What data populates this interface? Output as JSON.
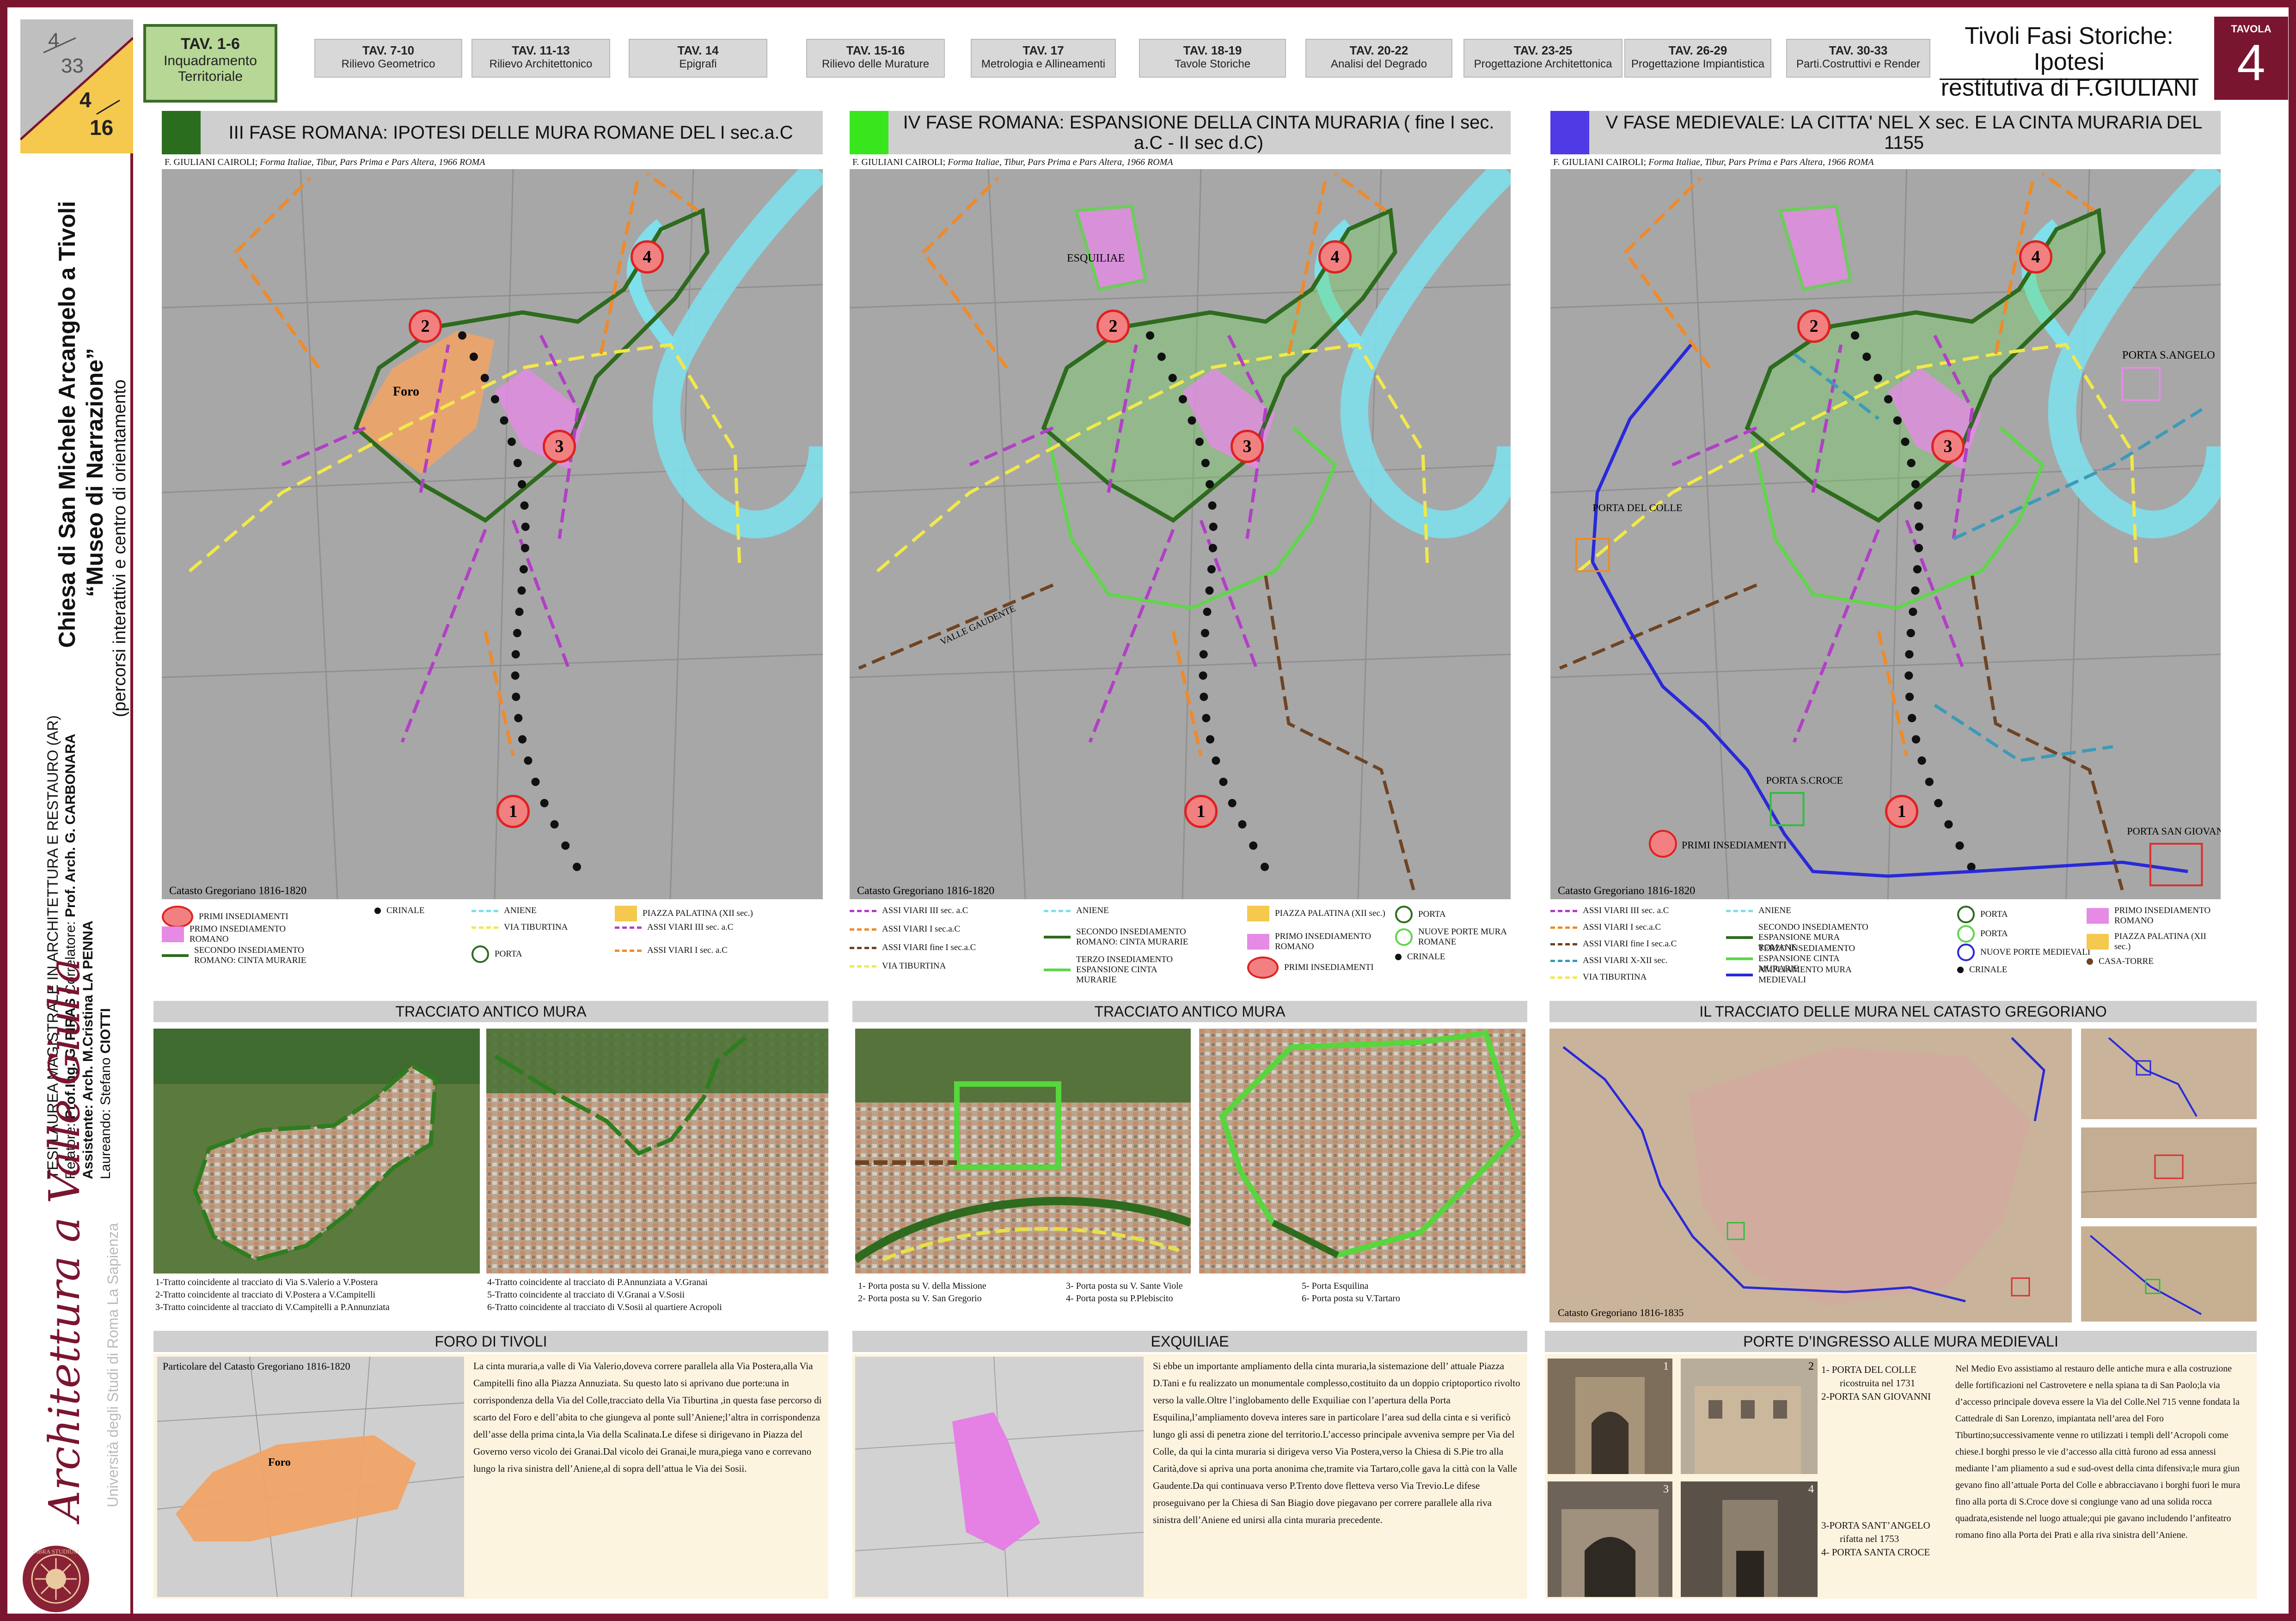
{
  "colors": {
    "frame": "#7a1530",
    "active_tab": "#b7d796",
    "phase3": "#2a6d1f",
    "phase4": "#39e61d",
    "phase5": "#4f3ae6",
    "aniene": "#7fdfeb",
    "walls_dark": "#2e6b1e",
    "walls_light": "#5fd64a",
    "walls_blue": "#2929d9",
    "viari3": "#b23fc6",
    "viari1": "#f08a28",
    "viari_fine": "#6e4424",
    "tiburtina": "#f2e84a",
    "viari_x": "#3d9ab8"
  },
  "page_badge": {
    "top": "4",
    "top_den": "33",
    "bottom": "4",
    "bottom_den": "16"
  },
  "title_block": {
    "title_line1": "Chiesa di San Michele Arcangelo a Tivoli",
    "title_line2": "“Museo di Narrazione”",
    "subtitle": "(percorsi interattivi e centro di orientamento"
  },
  "thesis_block": {
    "line1": "TESI LAUREA MAGISTRALE IN ARCHITETTURA E RESTAURO (AR)",
    "line2_a": "Relatore: ",
    "line2_b": "Prof.Ing. G. PIRAS ",
    "line2_c": "Correlatore: ",
    "line2_d": "Prof. Arch. G. CARBONARA",
    "line3_a": "Assistente: ",
    "line3_b": "Arch. M.Cristina ",
    "line3_c": "LA PENNA",
    "line4_a": "Laureando: Stefano ",
    "line4_b": "CIOTTI"
  },
  "logo": {
    "text": "Architettura a Valle Giulia",
    "university": "Università degli Studi di Roma La Sapienza",
    "seal": "SIBRA STUDIUM"
  },
  "tabs": [
    {
      "l1": "TAV. 1-6",
      "l2": "Inquadramento",
      "l3": "Territoriale",
      "active": true
    },
    {
      "l1": "TAV. 7-10",
      "l2": "Rilievo Geometrico"
    },
    {
      "l1": "TAV. 11-13",
      "l2": "Rilievo Architettonico"
    },
    {
      "l1": "TAV. 14",
      "l2": "Epigrafi"
    },
    {
      "l1": "TAV. 15-16",
      "l2": "Rilievo delle Murature"
    },
    {
      "l1": "TAV. 17",
      "l2": "Metrologia e Allineamenti"
    },
    {
      "l1": "TAV. 18-19",
      "l2": "Tavole Storiche"
    },
    {
      "l1": "TAV. 20-22",
      "l2": "Analisi del Degrado"
    },
    {
      "l1": "TAV. 23-25",
      "l2": "Progettazione Architettonica"
    },
    {
      "l1": "TAV. 26-29",
      "l2": "Progettazione Impiantistica"
    },
    {
      "l1": "TAV. 30-33",
      "l2": "Parti.Costruttivi e Render"
    }
  ],
  "header_title": {
    "line1": "Tivoli Fasi Storiche: Ipotesi",
    "line2": "restitutiva di F.GIULIANI"
  },
  "tavola": {
    "label": "TAVOLA",
    "number": "4"
  },
  "panels": [
    {
      "header": "III FASE ROMANA: IPOTESI DELLE MURA ROMANE DEL I sec.a.C",
      "credit_a": "F. GIULIANI CAIROLI; ",
      "credit_b": "Forma Italiae, Tibur, Pars Prima e Pars Altera, 1966 ROMA",
      "catasto": "Catasto Gregoriano 1816-1820",
      "map_labels": [
        "Foro",
        "1",
        "2",
        "3",
        "4"
      ],
      "legend": [
        "PRIMI INSEDIAMENTI",
        "PRIMO INSEDIAMENTO ROMANO",
        "SECONDO INSEDIAMENTO ROMANO: CINTA MURARIE",
        "CRINALE",
        "ANIENE",
        "VIA TIBURTINA",
        "PORTA",
        "PIAZZA PALATINA (XII sec.)",
        "ASSI VIARI III sec. a.C",
        "ASSI VIARI I sec. a.C"
      ]
    },
    {
      "header": "IV FASE ROMANA: ESPANSIONE DELLA CINTA MURARIA ( fine I sec. a.C - II sec d.C)",
      "credit_a": "F. GIULIANI CAIROLI; ",
      "credit_b": "Forma Italiae, Tibur, Pars Prima e Pars Altera, 1966 ROMA",
      "catasto": "Catasto Gregoriano 1816-1820",
      "map_labels": [
        "ESQUILIAE",
        "VALLE GAUDENTE",
        "1",
        "2",
        "3",
        "4"
      ],
      "legend": [
        "ASSI VIARI III sec. a.C",
        "ASSI VIARI I sec.a.C",
        "ASSI VIARI fine I sec.a.C",
        "VIA TIBURTINA",
        "ANIENE",
        "SECONDO INSEDIAMENTO ROMANO: CINTA MURARIE",
        "TERZO INSEDIAMENTO ESPANSIONE CINTA MURARIE",
        "PIAZZA PALATINA (XII sec.)",
        "PRIMO INSEDIAMENTO ROMANO",
        "PRIMI INSEDIAMENTI",
        "PORTA",
        "NUOVE PORTE MURA ROMANE",
        "CRINALE"
      ]
    },
    {
      "header": "V FASE MEDIEVALE: LA CITTA' NEL X sec. E LA CINTA MURARIA DEL 1155",
      "credit_a": "F. GIULIANI CAIROLI; ",
      "credit_b": "Forma Italiae, Tibur, Pars Prima e Pars Altera, 1966 ROMA",
      "catasto": "Catasto Gregoriano 1816-1820",
      "map_labels": [
        "PORTA S.ANGELO",
        "PORTA DEL COLLE",
        "PORTA S.CROCE",
        "PORTA SAN GIOVANNI",
        "PRIMI INSEDIAMENTI",
        "1",
        "2",
        "3",
        "4"
      ],
      "legend": [
        "ASSI VIARI III sec. a.C",
        "ASSI VIARI I sec.a.C",
        "ASSI VIARI fine I sec.a.C",
        "ASSI VIARI X-XII sec.",
        "VIA TIBURTINA",
        "ANIENE",
        "SECONDO INSEDIAMENTO ESPANSIONE MURA ROMANE",
        "TERZO INSEDIAMENTO ESPANSIONE CINTA MURARIE",
        "AMPLIAMENTO MURA MEDIEVALI",
        "PORTA",
        "PORTA",
        "NUOVE PORTE MEDIEVALI",
        "CRINALE",
        "PRIMO INSEDIAMENTO ROMANO",
        "PIAZZA PALATINA (XII sec.)",
        "CASA-TORRE"
      ]
    }
  ],
  "tracciato1": {
    "header": "TRACCIATO ANTICO MURA",
    "cap_left": [
      "1-Tratto coincidente al tracciato di Via S.Valerio a V.Postera",
      "2-Tratto coincidente al tracciato di V.Postera a V.Campitelli",
      "3-Tratto coincidente al tracciato di V.Campitelli a P.Annunziata"
    ],
    "cap_right": [
      "4-Tratto coincidente al tracciato di P.Annunziata a V.Granai",
      "5-Tratto coincidente al tracciato di V.Granai a V.Sosii",
      "6-Tratto coincidente al tracciato di V.Sosii al quartiere Acropoli"
    ]
  },
  "tracciato2": {
    "header": "TRACCIATO ANTICO MURA",
    "cap_col1": [
      "1- Porta posta su V. della Missione",
      "2- Porta posta su V. San Gregorio"
    ],
    "cap_col2": [
      "3- Porta posta su V. Sante Viole",
      "4- Porta posta su P.Plebiscito"
    ],
    "cap_col3": [
      "5- Porta Esquilina",
      "6- Porta posta su V.Tartaro"
    ]
  },
  "catasto_panel": {
    "header": "IL TRACCIATO DELLE MURA NEL CATASTO GREGORIANO",
    "caption": "Catasto Gregoriano 1816-1835"
  },
  "foro": {
    "header": "FORO DI TIVOLI",
    "map_caption": "Particolare del Catasto Gregoriano 1816-1820",
    "map_label": "Foro",
    "text": "La cinta muraria,a valle di Via Valerio,doveva correre parallela alla Via Postera,alla Via Campitelli fino alla Piazza Annuziata. Su questo lato si aprivano due porte:una in corrispondenza della Via del Colle,tracciato della Via Tiburtina ,in questa fase percorso di scarto del Foro e dell’abita to che giungeva al ponte sull’Aniene;l’altra in corrispondenza dell’asse della prima cinta,la Via della Scalinata.Le difese si dirigevano in Piazza del Governo verso vicolo dei Granai.Dal vicolo dei Granai,le mura,piega vano  e  correvano lungo la riva sinistra dell’Aniene,al di sopra dell’attua le Via dei Sosii."
  },
  "esquiliae": {
    "header": "EXQUILIAE",
    "text": "Si ebbe un importante ampliamento della cinta muraria,la sistemazione dell’ attuale Piazza D.Tani e fu realizzato un monumentale complesso,costituito da un doppio criptoportico rivolto verso la valle.Oltre l’inglobamento delle Exquiliae con l’apertura della Porta Esquilina,l’ampliamento doveva interes sare in particolare l’area sud della cinta e si verificò lungo gli assi di penetra zione del territorio.L’accesso principale avveniva sempre per Via del Colle, da qui la cinta muraria si dirigeva verso Via Postera,verso la Chiesa di S.Pie tro alla Carità,dove si apriva una porta anonima che,tramite via Tartaro,colle gava la città con la Valle Gaudente.Da qui continuava verso P.Trento dove fletteva verso Via Trevio.Le difese proseguivano per la Chiesa di San Biagio dove piegavano per correre parallele alla riva sinistra dell’Aniene ed unirsi alla cinta muraria precedente."
  },
  "porte": {
    "header": "PORTE D’INGRESSO ALLE MURA MEDIEVALI",
    "photo_nums": [
      "1",
      "2",
      "3",
      "4"
    ],
    "list": [
      "1- PORTA DEL COLLE",
      "ricostruita nel 1731",
      "2-PORTA SAN GIOVANNI",
      "3-PORTA SANT’ANGELO",
      "rifatta nel 1753",
      "4- PORTA SANTA CROCE"
    ],
    "text": "Nel Medio Evo assistiamo al restauro delle antiche mura e alla costruzione delle fortificazioni nel Castrovetere e nella spiana ta di San Paolo;la via d’accesso principale doveva essere la Via del Colle.Nel 715 venne fondata la Cattedrale di San Lorenzo, impiantata nell’area del Foro Tiburtino;successivamente venne ro utilizzati i templi dell’Acropoli come chiese.I borghi presso le vie d’accesso alla città furono ad essa annessi mediante l’am pliamento a sud e sud-ovest della cinta difensiva;le mura giun gevano fino all’attuale Porta del Colle e abbracciavano i borghi fuori le mura fino alla porta di S.Croce dove si congiunge vano ad una solida rocca quadrata,esistende nel luogo attuale;qui pie gavano includendo l’anfiteatro romano fino alla Porta dei Prati e alla riva sinistra dell’Aniene."
  }
}
